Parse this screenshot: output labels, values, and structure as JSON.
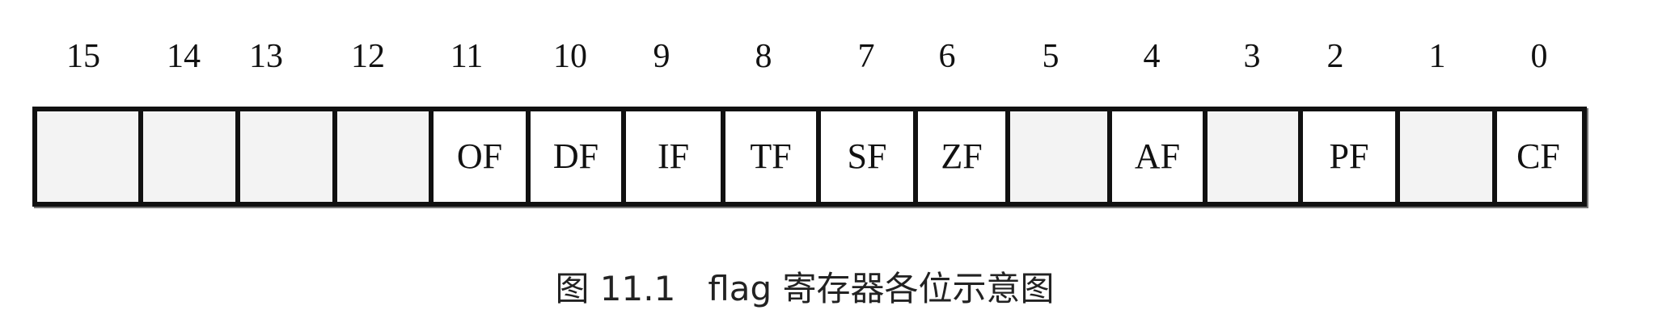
{
  "bit_numbers": [
    "15",
    "14",
    "13",
    "12",
    "11",
    "10",
    "9",
    "8",
    "7",
    "6",
    "5",
    "4",
    "3",
    "2",
    "1",
    "0"
  ],
  "flag_cells": [
    "",
    "",
    "",
    "",
    "OF",
    "DF",
    "IF",
    "TF",
    "SF",
    "ZF",
    "",
    "AF",
    "",
    "PF",
    "",
    "CF"
  ],
  "caption": "图 11.1   flag 寄存器各位示意图",
  "colors": {
    "line": "#111111",
    "empty_cell": "#f3f3f3",
    "text": "#111111"
  }
}
